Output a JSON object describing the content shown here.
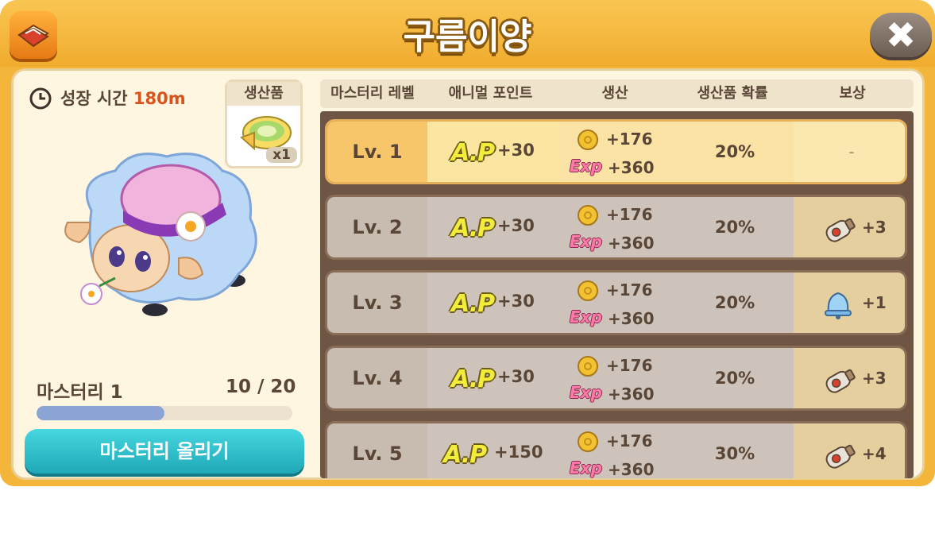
{
  "window": {
    "title": "구름이양"
  },
  "info": {
    "growth_label": "성장 시간",
    "growth_value": "180m",
    "product_header": "생산품",
    "product_qty": "x1"
  },
  "mastery": {
    "label": "마스터리 1",
    "count": "10 / 20",
    "progress": 0.5,
    "button_label": "마스터리 올리기"
  },
  "table": {
    "headers": [
      "마스터리 레벨",
      "애니멀 포인트",
      "생산",
      "생산품 확률",
      "보상"
    ],
    "rows": [
      {
        "level": "Lv. 1",
        "ap_logo": "A.P",
        "ap": "+30",
        "gold": "+176",
        "exp_logo": "Exp",
        "exp": "+360",
        "chance": "20%",
        "reward": "-",
        "reward_icon": "none",
        "state": "active"
      },
      {
        "level": "Lv. 2",
        "ap_logo": "A.P",
        "ap": "+30",
        "gold": "+176",
        "exp_logo": "Exp",
        "exp": "+360",
        "chance": "20%",
        "reward": "+3",
        "reward_icon": "bottle-icon",
        "state": "locked"
      },
      {
        "level": "Lv. 3",
        "ap_logo": "A.P",
        "ap": "+30",
        "gold": "+176",
        "exp_logo": "Exp",
        "exp": "+360",
        "chance": "20%",
        "reward": "+1",
        "reward_icon": "bell-icon",
        "state": "locked"
      },
      {
        "level": "Lv. 4",
        "ap_logo": "A.P",
        "ap": "+30",
        "gold": "+176",
        "exp_logo": "Exp",
        "exp": "+360",
        "chance": "20%",
        "reward": "+3",
        "reward_icon": "bottle-icon",
        "state": "locked"
      },
      {
        "level": "Lv. 5",
        "ap_logo": "A.P",
        "ap": "+150",
        "gold": "+176",
        "exp_logo": "Exp",
        "exp": "+360",
        "chance": "30%",
        "reward": "+4",
        "reward_icon": "bottle-icon",
        "state": "locked"
      }
    ]
  },
  "colors": {
    "frame": "#f3b63a",
    "accent_text": "#d9531d",
    "button": "#1fa8b7",
    "progress": "#8aa4d6"
  }
}
